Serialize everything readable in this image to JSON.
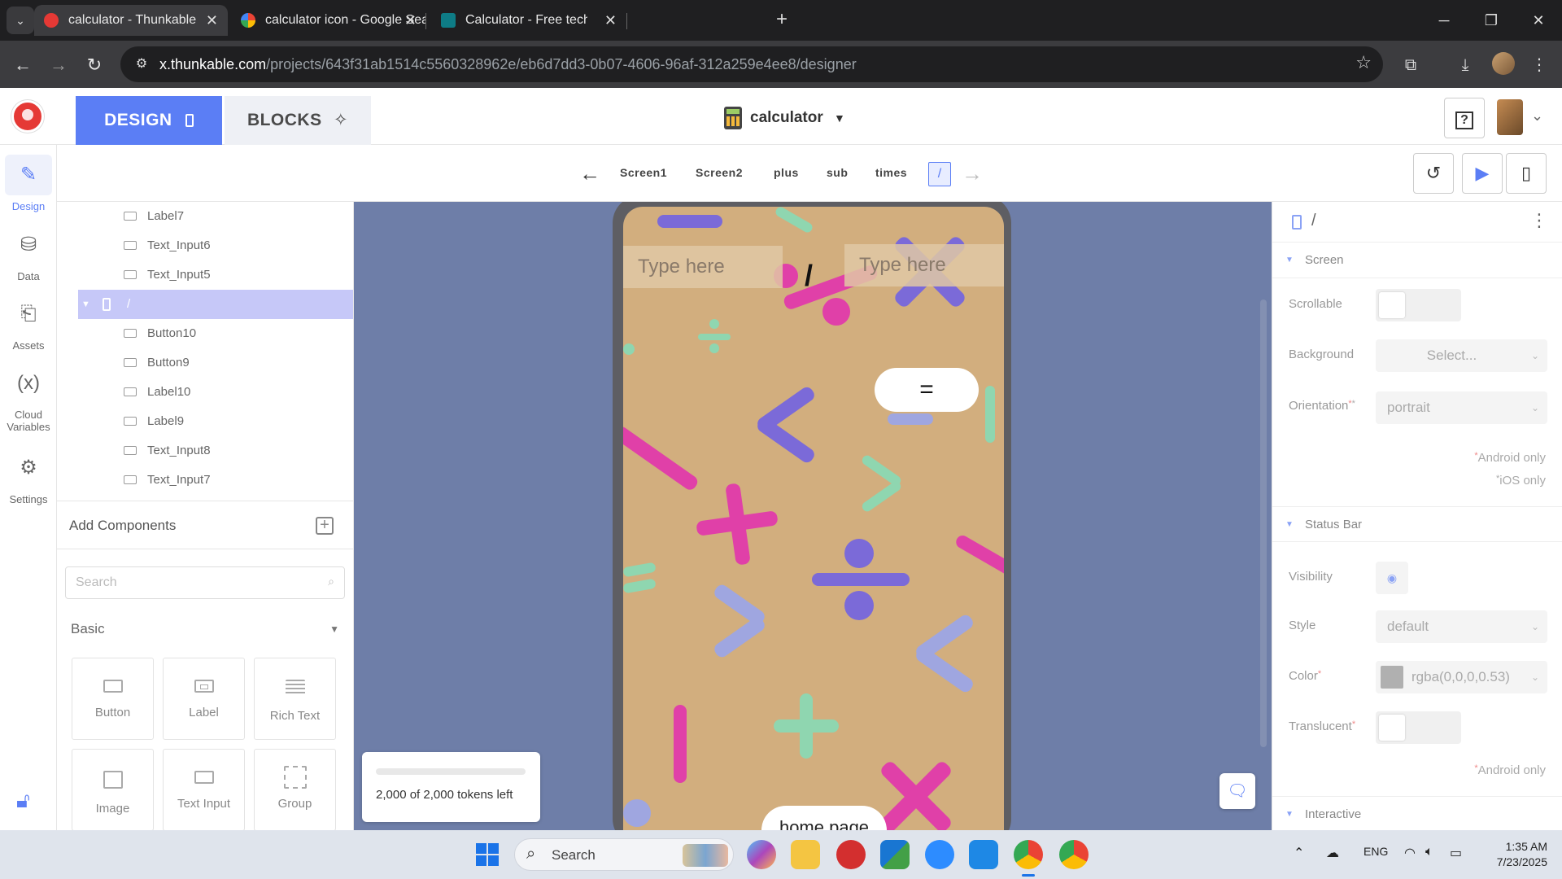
{
  "browser": {
    "tabs": [
      {
        "title": "calculator - Thunkable",
        "active": true,
        "close": "✕"
      },
      {
        "title": "calculator icon - Google Search",
        "active": false,
        "close": "✕"
      },
      {
        "title": "Calculator - Free technology icons",
        "active": false,
        "close": "✕"
      }
    ],
    "url_host": "x.thunkable.com",
    "url_path": "/projects/643f31ab1514c5560328962e/eb6d7dd3-0b07-4606-96af-312a259e4ee8/designer"
  },
  "app": {
    "design_tab": "DESIGN",
    "blocks_tab": "BLOCKS",
    "project_name": "calculator",
    "help_label": "?"
  },
  "screens": {
    "items": [
      "Screen1",
      "Screen2",
      "plus",
      "sub",
      "times"
    ],
    "active": "/"
  },
  "rail": [
    {
      "label": "Design",
      "icon": "brush-icon",
      "active": true
    },
    {
      "label": "Data",
      "icon": "database-icon",
      "active": false
    },
    {
      "label": "Assets",
      "icon": "file-icon",
      "active": false
    },
    {
      "label": "Cloud Variables",
      "icon": "variable-icon",
      "active": false
    },
    {
      "label": "Settings",
      "icon": "gear-icon",
      "active": false
    }
  ],
  "tree": {
    "items_before": [
      "Label7",
      "Text_Input6",
      "Text_Input5"
    ],
    "selected": "/",
    "items_after": [
      "Button10",
      "Button9",
      "Label10",
      "Label9",
      "Text_Input8",
      "Text_Input7"
    ]
  },
  "components": {
    "title": "Add Components",
    "search_placeholder": "Search",
    "category": "Basic",
    "tiles": [
      "Button",
      "Label",
      "Rich Text",
      "Image",
      "Text Input",
      "Group"
    ]
  },
  "canvas": {
    "input1_placeholder": "Type here",
    "input2_placeholder": "Type here",
    "operator_label": "/",
    "equals_button": "=",
    "home_button": "home page",
    "tokens_text": "2,000 of 2,000 tokens left",
    "tokens_used_fraction": 0
  },
  "properties": {
    "component_name": "/",
    "screen_section": "Screen",
    "scrollable_label": "Scrollable",
    "background_label": "Background",
    "background_value": "Select...",
    "orientation_label": "Orientation",
    "orientation_value": "portrait",
    "android_only": "Android only",
    "ios_only": "iOS only",
    "status_bar_section": "Status Bar",
    "visibility_label": "Visibility",
    "style_label": "Style",
    "style_value": "default",
    "color_label": "Color",
    "color_value": "rgba(0,0,0,0.53)",
    "translucent_label": "Translucent",
    "android_only_2": "Android only",
    "interactive_section": "Interactive"
  },
  "taskbar": {
    "search": "Search",
    "lang": "ENG",
    "time": "1:35 AM",
    "date": "7/23/2025"
  },
  "colors": {
    "accent": "#5b7ef5",
    "canvas_bg": "#6e7ea8",
    "screen_bg": "#d2ae7e",
    "pink": "#e040a8",
    "purple": "#7b6ad8",
    "mint": "#8fd6b0",
    "lavender": "#9fa6e0"
  }
}
